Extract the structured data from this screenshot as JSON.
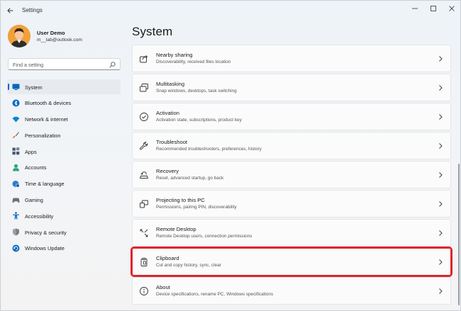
{
  "window": {
    "title": "Settings"
  },
  "user": {
    "name": "User Demo",
    "email": "m__lab@outlook.com"
  },
  "search": {
    "placeholder": "Find a setting"
  },
  "nav": {
    "items": [
      {
        "label": "System",
        "icon": "monitor-icon",
        "color": "#0067c0",
        "active": true
      },
      {
        "label": "Bluetooth & devices",
        "icon": "bluetooth-icon",
        "color": "#0067c0"
      },
      {
        "label": "Network & internet",
        "icon": "wifi-icon",
        "color": "#0a84d6"
      },
      {
        "label": "Personalization",
        "icon": "brush-icon",
        "color": "#e8883a"
      },
      {
        "label": "Apps",
        "icon": "apps-icon",
        "color": "#4a5a6e"
      },
      {
        "label": "Accounts",
        "icon": "person-icon",
        "color": "#2aa776"
      },
      {
        "label": "Time & language",
        "icon": "globe-clock-icon",
        "color": "#2a7fd4"
      },
      {
        "label": "Gaming",
        "icon": "gamepad-icon",
        "color": "#6a6f76"
      },
      {
        "label": "Accessibility",
        "icon": "accessibility-icon",
        "color": "#1a73c9"
      },
      {
        "label": "Privacy & security",
        "icon": "shield-icon",
        "color": "#6a6f76"
      },
      {
        "label": "Windows Update",
        "icon": "update-icon",
        "color": "#0a6cc2"
      }
    ]
  },
  "main": {
    "title": "System",
    "cards": [
      {
        "title": "Nearby sharing",
        "desc": "Discoverability, received files location",
        "icon": "share-icon"
      },
      {
        "title": "Multitasking",
        "desc": "Snap windows, desktops, task switching",
        "icon": "multitask-icon"
      },
      {
        "title": "Activation",
        "desc": "Activation state, subscriptions, product key",
        "icon": "check-circle-icon"
      },
      {
        "title": "Troubleshoot",
        "desc": "Recommended troubleshooters, preferences, history",
        "icon": "wrench-icon"
      },
      {
        "title": "Recovery",
        "desc": "Reset, advanced startup, go back",
        "icon": "recovery-icon"
      },
      {
        "title": "Projecting to this PC",
        "desc": "Permissions, pairing PIN, discoverability",
        "icon": "project-icon"
      },
      {
        "title": "Remote Desktop",
        "desc": "Remote Desktop users, connection permissions",
        "icon": "remote-icon"
      },
      {
        "title": "Clipboard",
        "desc": "Cut and copy history, sync, clear",
        "icon": "clipboard-icon",
        "highlighted": true
      },
      {
        "title": "About",
        "desc": "Device specifications, rename PC, Windows specifications",
        "icon": "info-icon"
      }
    ]
  },
  "colors": {
    "accent": "#0067c0",
    "highlight": "#e0232b"
  }
}
